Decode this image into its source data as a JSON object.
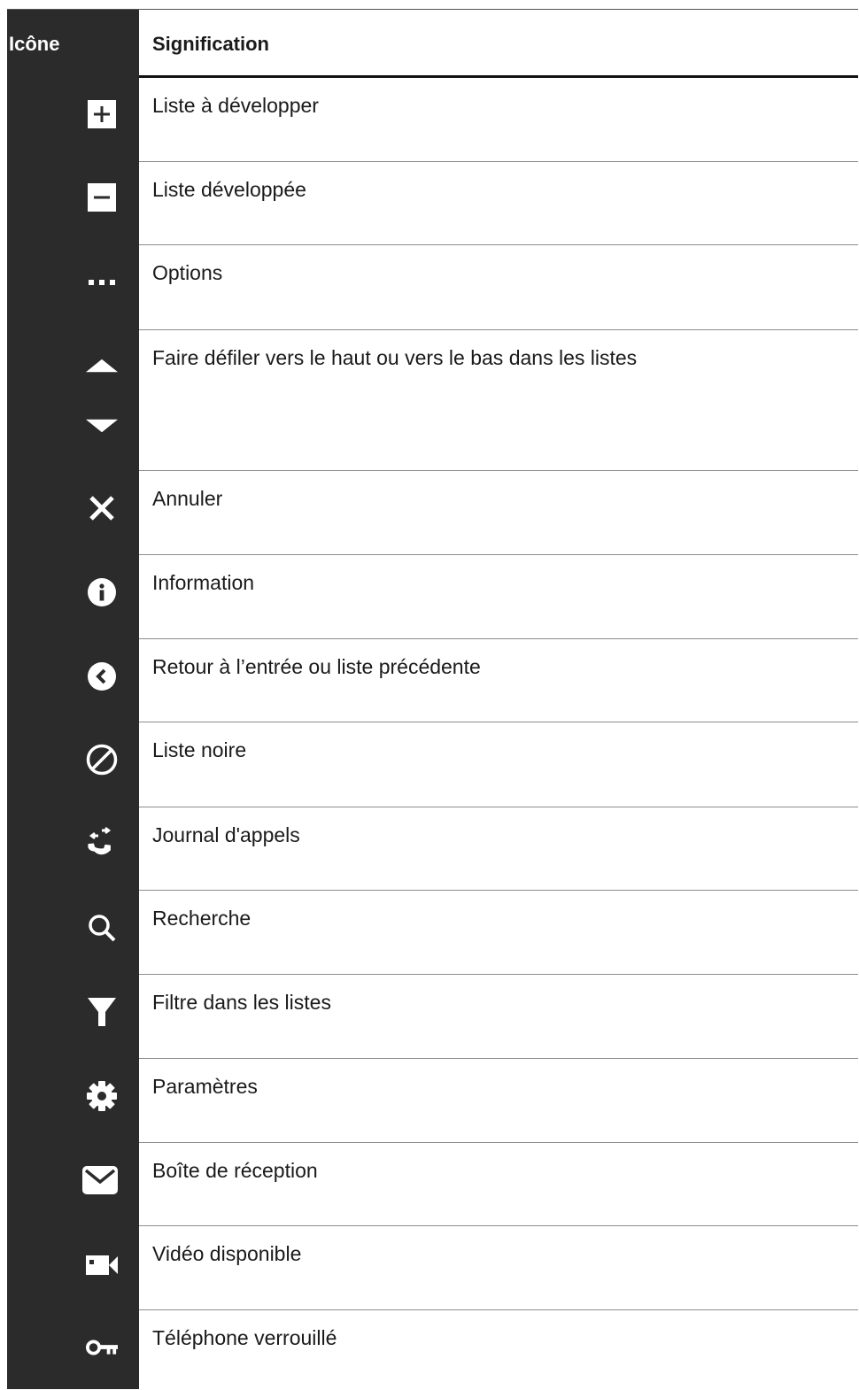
{
  "header": {
    "icon_col": "Icône",
    "meaning_col": "Signification"
  },
  "rows": [
    {
      "icon": "plus-box-icon",
      "label": "Liste à développer"
    },
    {
      "icon": "minus-box-icon",
      "label": "Liste développée"
    },
    {
      "icon": "more-dots-icon",
      "label": "Options"
    },
    {
      "icon": "scroll-up-down-icon",
      "label": "Faire défiler vers le haut ou vers le bas dans les listes"
    },
    {
      "icon": "close-x-icon",
      "label": "Annuler"
    },
    {
      "icon": "info-circle-icon",
      "label": "Information"
    },
    {
      "icon": "back-chevron-circle-icon",
      "label": "Retour à l’entrée ou liste précédente"
    },
    {
      "icon": "blocked-circle-icon",
      "label": "Liste noire"
    },
    {
      "icon": "call-log-phone-icon",
      "label": "Journal d'appels"
    },
    {
      "icon": "search-magnifier-icon",
      "label": "Recherche"
    },
    {
      "icon": "filter-funnel-icon",
      "label": "Filtre dans les listes"
    },
    {
      "icon": "settings-gear-icon",
      "label": "Paramètres"
    },
    {
      "icon": "mail-envelope-icon",
      "label": "Boîte de réception"
    },
    {
      "icon": "video-camera-icon",
      "label": "Vidéo disponible"
    },
    {
      "icon": "key-lock-icon",
      "label": "Téléphone verrouillé"
    }
  ],
  "colors": {
    "icon_column_bg": "#2b2b2b",
    "icon_fg": "#ffffff",
    "row_divider": "#8c8c8c"
  }
}
